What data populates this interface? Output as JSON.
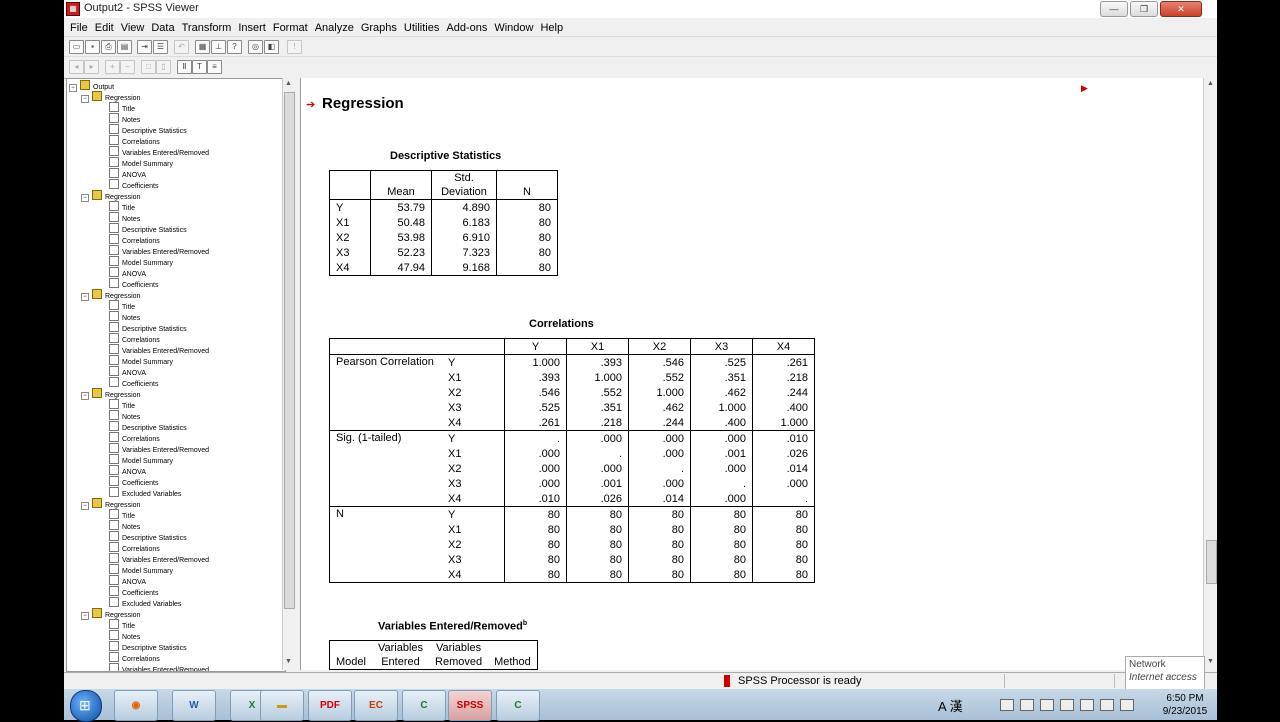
{
  "window": {
    "title": "Output2 - SPSS Viewer",
    "minimize": "—",
    "restore": "❐",
    "close": "✕"
  },
  "menu": [
    "File",
    "Edit",
    "View",
    "Data",
    "Transform",
    "Insert",
    "Format",
    "Analyze",
    "Graphs",
    "Utilities",
    "Add-ons",
    "Window",
    "Help"
  ],
  "outline": {
    "root": "Output",
    "groups": [
      {
        "label": "Regression",
        "items": [
          "Title",
          "Notes",
          "Descriptive Statistics",
          "Correlations",
          "Variables Entered/Removed",
          "Model Summary",
          "ANOVA",
          "Coefficients"
        ]
      },
      {
        "label": "Regression",
        "items": [
          "Title",
          "Notes",
          "Descriptive Statistics",
          "Correlations",
          "Variables Entered/Removed",
          "Model Summary",
          "ANOVA",
          "Coefficients"
        ]
      },
      {
        "label": "Regression",
        "items": [
          "Title",
          "Notes",
          "Descriptive Statistics",
          "Correlations",
          "Variables Entered/Removed",
          "Model Summary",
          "ANOVA",
          "Coefficients"
        ]
      },
      {
        "label": "Regression",
        "items": [
          "Title",
          "Notes",
          "Descriptive Statistics",
          "Correlations",
          "Variables Entered/Removed",
          "Model Summary",
          "ANOVA",
          "Coefficients",
          "Excluded Variables"
        ]
      },
      {
        "label": "Regression",
        "items": [
          "Title",
          "Notes",
          "Descriptive Statistics",
          "Correlations",
          "Variables Entered/Removed",
          "Model Summary",
          "ANOVA",
          "Coefficients",
          "Excluded Variables"
        ]
      },
      {
        "label": "Regression",
        "items": [
          "Title",
          "Notes",
          "Descriptive Statistics",
          "Correlations",
          "Variables Entered/Removed"
        ]
      }
    ]
  },
  "content": {
    "section_title": "Regression",
    "descriptives": {
      "title": "Descriptive Statistics",
      "headers": [
        "",
        "Mean",
        "Std.\nDeviation",
        "N"
      ],
      "rows": [
        [
          "Y",
          "53.79",
          "4.890",
          "80"
        ],
        [
          "X1",
          "50.48",
          "6.183",
          "80"
        ],
        [
          "X2",
          "53.98",
          "6.910",
          "80"
        ],
        [
          "X3",
          "52.23",
          "7.323",
          "80"
        ],
        [
          "X4",
          "47.94",
          "9.168",
          "80"
        ]
      ]
    },
    "correlations": {
      "title": "Correlations",
      "headers": [
        "",
        "",
        "Y",
        "X1",
        "X2",
        "X3",
        "X4"
      ],
      "groups": [
        {
          "label": "Pearson Correlation",
          "rows": [
            [
              "Y",
              "1.000",
              ".393",
              ".546",
              ".525",
              ".261"
            ],
            [
              "X1",
              ".393",
              "1.000",
              ".552",
              ".351",
              ".218"
            ],
            [
              "X2",
              ".546",
              ".552",
              "1.000",
              ".462",
              ".244"
            ],
            [
              "X3",
              ".525",
              ".351",
              ".462",
              "1.000",
              ".400"
            ],
            [
              "X4",
              ".261",
              ".218",
              ".244",
              ".400",
              "1.000"
            ]
          ]
        },
        {
          "label": "Sig. (1-tailed)",
          "rows": [
            [
              "Y",
              ".",
              ".000",
              ".000",
              ".000",
              ".010"
            ],
            [
              "X1",
              ".000",
              ".",
              ".000",
              ".001",
              ".026"
            ],
            [
              "X2",
              ".000",
              ".000",
              ".",
              ".000",
              ".014"
            ],
            [
              "X3",
              ".000",
              ".001",
              ".000",
              ".",
              ".000"
            ],
            [
              "X4",
              ".010",
              ".026",
              ".014",
              ".000",
              "."
            ]
          ]
        },
        {
          "label": "N",
          "rows": [
            [
              "Y",
              "80",
              "80",
              "80",
              "80",
              "80"
            ],
            [
              "X1",
              "80",
              "80",
              "80",
              "80",
              "80"
            ],
            [
              "X2",
              "80",
              "80",
              "80",
              "80",
              "80"
            ],
            [
              "X3",
              "80",
              "80",
              "80",
              "80",
              "80"
            ],
            [
              "X4",
              "80",
              "80",
              "80",
              "80",
              "80"
            ]
          ]
        }
      ]
    },
    "varsEntered": {
      "title": "Variables Entered/Removed",
      "title_sup": "b",
      "headers": [
        "Model",
        "Variables\nEntered",
        "Variables\nRemoved",
        "Method"
      ]
    }
  },
  "status": {
    "text": "SPSS Processor  is ready"
  },
  "tooltip": {
    "line1": "Network",
    "line2": "Internet access"
  },
  "taskbar": {
    "apps": [
      "Firefox",
      "W",
      "X",
      "Files",
      "PDF",
      "EC",
      "C",
      "SPSS",
      "C"
    ],
    "lang": "A 漢",
    "time": "6:50 PM",
    "date": "9/23/2015"
  }
}
